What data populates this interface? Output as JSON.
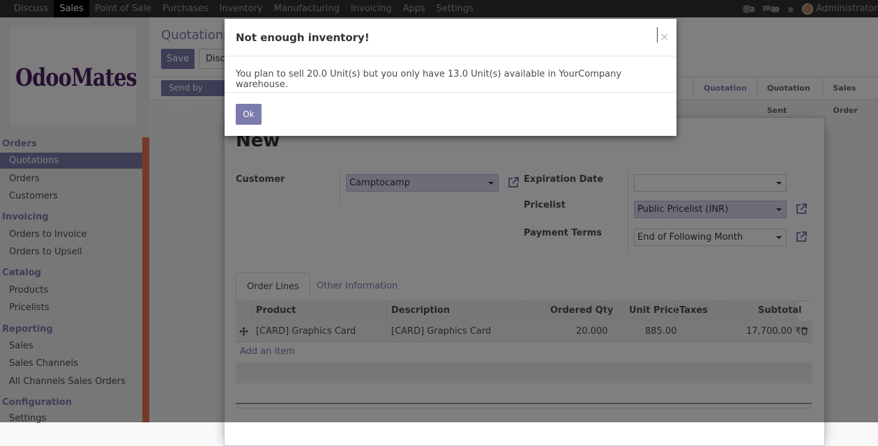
{
  "navbar": {
    "menu": [
      "Discuss",
      "Sales",
      "Point of Sale",
      "Purchases",
      "Inventory",
      "Manufacturing",
      "Invoicing",
      "Apps",
      "Settings"
    ],
    "active": "Sales",
    "messages_count": "2",
    "activities_count": "10",
    "user": "Administrator"
  },
  "sidebar": {
    "logo": "OdooMates",
    "sections": {
      "orders": "Orders",
      "invoicing": "Invoicing",
      "catalog": "Catalog",
      "reporting": "Reporting",
      "configuration": "Configuration"
    },
    "items": {
      "quotations": "Quotations",
      "orders": "Orders",
      "customers": "Customers",
      "orders_to_invoice": "Orders to Invoice",
      "orders_to_upsell": "Orders to Upsell",
      "products": "Products",
      "pricelists": "Pricelists",
      "sales": "Sales",
      "sales_channels": "Sales Channels",
      "all_channels_sales_orders": "All Channels Sales Orders",
      "settings": "Settings"
    }
  },
  "control_panel": {
    "breadcrumb": "Quotations",
    "save": "Save",
    "discard": "Discard",
    "send_by_email": "Send by Email",
    "stages": [
      "Quotation",
      "Quotation Sent",
      "Sales Order"
    ],
    "current_stage": "Quotation"
  },
  "form": {
    "title": "New",
    "customer_label": "Customer",
    "customer_value": "Camptocamp",
    "expiration_label": "Expiration Date",
    "expiration_value": "",
    "pricelist_label": "Pricelist",
    "pricelist_value": "Public Pricelist (INR)",
    "payment_terms_label": "Payment Terms",
    "payment_terms_value": "End of Following Month",
    "tabs": [
      "Order Lines",
      "Other Information"
    ],
    "columns": [
      "Product",
      "Description",
      "Ordered Qty",
      "Unit Price",
      "Taxes",
      "Subtotal"
    ],
    "line": {
      "product": "[CARD] Graphics Card",
      "description": "[CARD] Graphics Card",
      "qty": "20.000",
      "unit_price": "885.00",
      "taxes": "",
      "subtotal": "17,700.00 ₹"
    },
    "add_item": "Add an item"
  },
  "modal": {
    "title": "Not enough inventory!",
    "close": "×",
    "message": "You plan to sell 20.0 Unit(s) but you only have 13.0 Unit(s) available in YourCompany warehouse.",
    "ok": "Ok"
  },
  "colors": {
    "navbar": "#313131",
    "brand": "#7c7bad",
    "sidebar_strip": "#e8744f"
  }
}
